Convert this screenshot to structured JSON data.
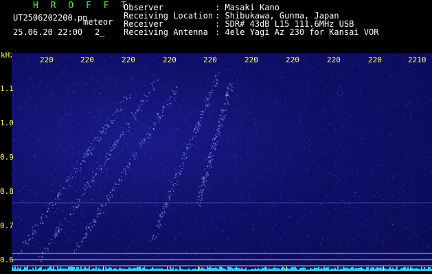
{
  "header": {
    "app_name": "H R O F F T",
    "filename": "UT2506202200.pn",
    "mode": "meteor",
    "date_time": "25.06.20 22:00",
    "index": "2_",
    "fields": [
      {
        "label": "Observer",
        "value": ": Masaki Kano"
      },
      {
        "label": "Receiving Location",
        "value": ": Shibukawa, Gunma, Japan"
      },
      {
        "label": "Receiver",
        "value": ": SDR# 43dB L15 111.6MHz USB"
      },
      {
        "label": "Receiving Antenna",
        "value": ": 4ele Yagi Az 230 for Kansai VOR"
      }
    ]
  },
  "axes": {
    "y_unit": "kHz",
    "y_ticks": [
      "1.1",
      "1.0",
      "0.9",
      "0.8",
      "0.7",
      "0.6"
    ],
    "x_ticks": [
      "220",
      "220",
      "220",
      "220",
      "220",
      "220",
      "220",
      "220",
      "220",
      "2210"
    ]
  },
  "colors": {
    "background": "#000000",
    "spectrogram": "#0e0e66",
    "signal": "#6a8cff",
    "label": "#ffff66",
    "title": "#33ff33",
    "bottom_trace": "#33ccff"
  }
}
